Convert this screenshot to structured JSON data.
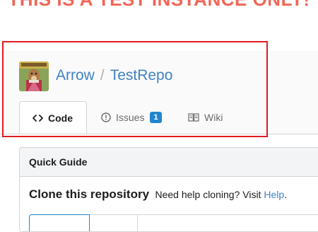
{
  "banner": {
    "text": "THIS IS A TEST INSTANCE ONLY!",
    "color": "#f26658"
  },
  "repo": {
    "owner": "Arrow",
    "separator": "/",
    "name": "TestRepo",
    "avatar_icon": "owner-avatar"
  },
  "tabs": [
    {
      "label": "Code",
      "icon": "code-icon",
      "active": true
    },
    {
      "label": "Issues",
      "icon": "issue-icon",
      "count": "1",
      "active": false
    },
    {
      "label": "Wiki",
      "icon": "book-icon",
      "active": false
    }
  ],
  "quick_guide": {
    "title": "Quick Guide",
    "clone_heading": "Clone this repository",
    "clone_help": "Need help cloning? Visit",
    "help_link": "Help",
    "help_suffix": "."
  },
  "colors": {
    "link": "#4183c4",
    "badge": "#2185d0",
    "highlight": "#e01b24"
  }
}
